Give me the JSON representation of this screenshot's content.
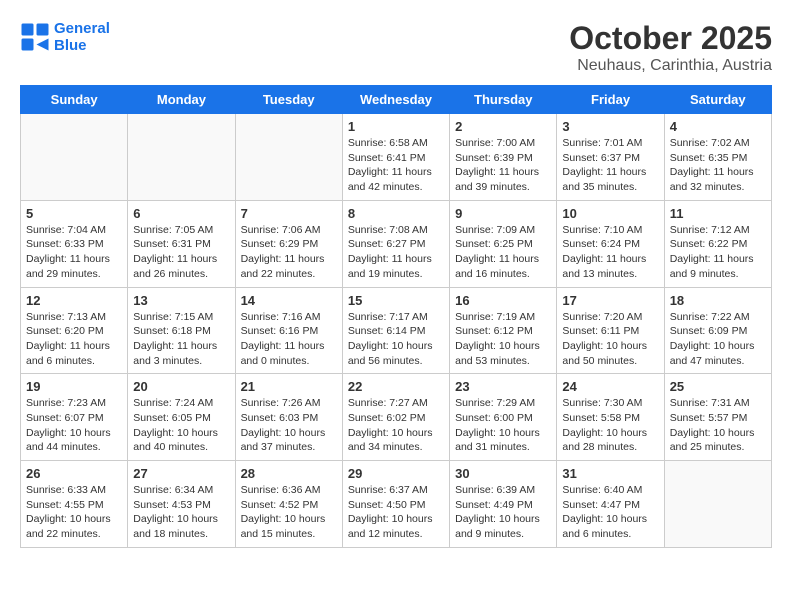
{
  "header": {
    "logo_line1": "General",
    "logo_line2": "Blue",
    "title": "October 2025",
    "subtitle": "Neuhaus, Carinthia, Austria"
  },
  "days_of_week": [
    "Sunday",
    "Monday",
    "Tuesday",
    "Wednesday",
    "Thursday",
    "Friday",
    "Saturday"
  ],
  "weeks": [
    [
      {
        "day": "",
        "info": ""
      },
      {
        "day": "",
        "info": ""
      },
      {
        "day": "",
        "info": ""
      },
      {
        "day": "1",
        "info": "Sunrise: 6:58 AM\nSunset: 6:41 PM\nDaylight: 11 hours and 42 minutes."
      },
      {
        "day": "2",
        "info": "Sunrise: 7:00 AM\nSunset: 6:39 PM\nDaylight: 11 hours and 39 minutes."
      },
      {
        "day": "3",
        "info": "Sunrise: 7:01 AM\nSunset: 6:37 PM\nDaylight: 11 hours and 35 minutes."
      },
      {
        "day": "4",
        "info": "Sunrise: 7:02 AM\nSunset: 6:35 PM\nDaylight: 11 hours and 32 minutes."
      }
    ],
    [
      {
        "day": "5",
        "info": "Sunrise: 7:04 AM\nSunset: 6:33 PM\nDaylight: 11 hours and 29 minutes."
      },
      {
        "day": "6",
        "info": "Sunrise: 7:05 AM\nSunset: 6:31 PM\nDaylight: 11 hours and 26 minutes."
      },
      {
        "day": "7",
        "info": "Sunrise: 7:06 AM\nSunset: 6:29 PM\nDaylight: 11 hours and 22 minutes."
      },
      {
        "day": "8",
        "info": "Sunrise: 7:08 AM\nSunset: 6:27 PM\nDaylight: 11 hours and 19 minutes."
      },
      {
        "day": "9",
        "info": "Sunrise: 7:09 AM\nSunset: 6:25 PM\nDaylight: 11 hours and 16 minutes."
      },
      {
        "day": "10",
        "info": "Sunrise: 7:10 AM\nSunset: 6:24 PM\nDaylight: 11 hours and 13 minutes."
      },
      {
        "day": "11",
        "info": "Sunrise: 7:12 AM\nSunset: 6:22 PM\nDaylight: 11 hours and 9 minutes."
      }
    ],
    [
      {
        "day": "12",
        "info": "Sunrise: 7:13 AM\nSunset: 6:20 PM\nDaylight: 11 hours and 6 minutes."
      },
      {
        "day": "13",
        "info": "Sunrise: 7:15 AM\nSunset: 6:18 PM\nDaylight: 11 hours and 3 minutes."
      },
      {
        "day": "14",
        "info": "Sunrise: 7:16 AM\nSunset: 6:16 PM\nDaylight: 11 hours and 0 minutes."
      },
      {
        "day": "15",
        "info": "Sunrise: 7:17 AM\nSunset: 6:14 PM\nDaylight: 10 hours and 56 minutes."
      },
      {
        "day": "16",
        "info": "Sunrise: 7:19 AM\nSunset: 6:12 PM\nDaylight: 10 hours and 53 minutes."
      },
      {
        "day": "17",
        "info": "Sunrise: 7:20 AM\nSunset: 6:11 PM\nDaylight: 10 hours and 50 minutes."
      },
      {
        "day": "18",
        "info": "Sunrise: 7:22 AM\nSunset: 6:09 PM\nDaylight: 10 hours and 47 minutes."
      }
    ],
    [
      {
        "day": "19",
        "info": "Sunrise: 7:23 AM\nSunset: 6:07 PM\nDaylight: 10 hours and 44 minutes."
      },
      {
        "day": "20",
        "info": "Sunrise: 7:24 AM\nSunset: 6:05 PM\nDaylight: 10 hours and 40 minutes."
      },
      {
        "day": "21",
        "info": "Sunrise: 7:26 AM\nSunset: 6:03 PM\nDaylight: 10 hours and 37 minutes."
      },
      {
        "day": "22",
        "info": "Sunrise: 7:27 AM\nSunset: 6:02 PM\nDaylight: 10 hours and 34 minutes."
      },
      {
        "day": "23",
        "info": "Sunrise: 7:29 AM\nSunset: 6:00 PM\nDaylight: 10 hours and 31 minutes."
      },
      {
        "day": "24",
        "info": "Sunrise: 7:30 AM\nSunset: 5:58 PM\nDaylight: 10 hours and 28 minutes."
      },
      {
        "day": "25",
        "info": "Sunrise: 7:31 AM\nSunset: 5:57 PM\nDaylight: 10 hours and 25 minutes."
      }
    ],
    [
      {
        "day": "26",
        "info": "Sunrise: 6:33 AM\nSunset: 4:55 PM\nDaylight: 10 hours and 22 minutes."
      },
      {
        "day": "27",
        "info": "Sunrise: 6:34 AM\nSunset: 4:53 PM\nDaylight: 10 hours and 18 minutes."
      },
      {
        "day": "28",
        "info": "Sunrise: 6:36 AM\nSunset: 4:52 PM\nDaylight: 10 hours and 15 minutes."
      },
      {
        "day": "29",
        "info": "Sunrise: 6:37 AM\nSunset: 4:50 PM\nDaylight: 10 hours and 12 minutes."
      },
      {
        "day": "30",
        "info": "Sunrise: 6:39 AM\nSunset: 4:49 PM\nDaylight: 10 hours and 9 minutes."
      },
      {
        "day": "31",
        "info": "Sunrise: 6:40 AM\nSunset: 4:47 PM\nDaylight: 10 hours and 6 minutes."
      },
      {
        "day": "",
        "info": ""
      }
    ]
  ]
}
